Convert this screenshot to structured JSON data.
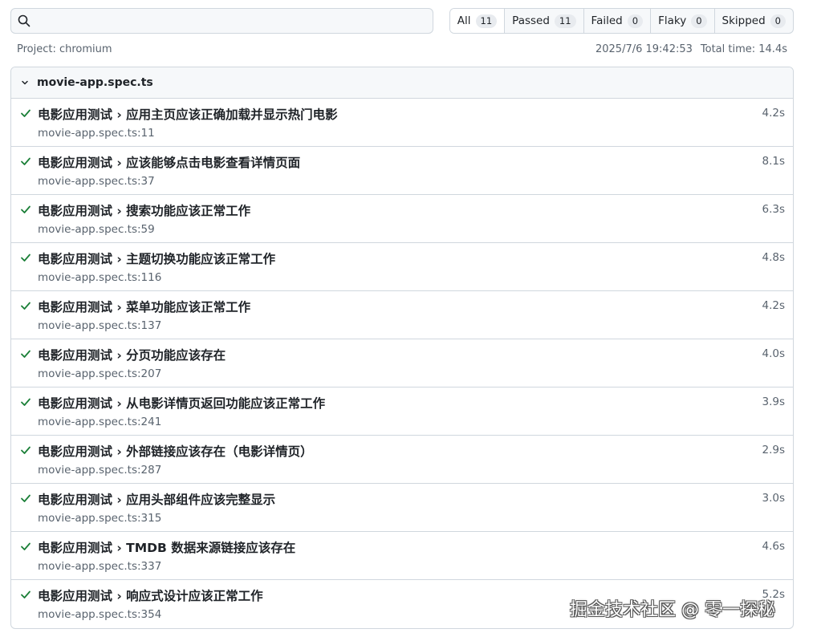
{
  "search": {
    "placeholder": "",
    "value": ""
  },
  "filters": [
    {
      "label": "All",
      "count": "11"
    },
    {
      "label": "Passed",
      "count": "11"
    },
    {
      "label": "Failed",
      "count": "0"
    },
    {
      "label": "Flaky",
      "count": "0"
    },
    {
      "label": "Skipped",
      "count": "0"
    }
  ],
  "meta": {
    "project": "Project: chromium",
    "timestamp": "2025/7/6 19:42:53",
    "total_time": "Total time: 14.4s"
  },
  "file": {
    "name": "movie-app.spec.ts",
    "tests": [
      {
        "title": "电影应用测试 › 应用主页应该正确加载并显示热门电影",
        "location": "movie-app.spec.ts:11",
        "duration": "4.2s",
        "status": "passed"
      },
      {
        "title": "电影应用测试 › 应该能够点击电影查看详情页面",
        "location": "movie-app.spec.ts:37",
        "duration": "8.1s",
        "status": "passed"
      },
      {
        "title": "电影应用测试 › 搜索功能应该正常工作",
        "location": "movie-app.spec.ts:59",
        "duration": "6.3s",
        "status": "passed"
      },
      {
        "title": "电影应用测试 › 主题切换功能应该正常工作",
        "location": "movie-app.spec.ts:116",
        "duration": "4.8s",
        "status": "passed"
      },
      {
        "title": "电影应用测试 › 菜单功能应该正常工作",
        "location": "movie-app.spec.ts:137",
        "duration": "4.2s",
        "status": "passed"
      },
      {
        "title": "电影应用测试 › 分页功能应该存在",
        "location": "movie-app.spec.ts:207",
        "duration": "4.0s",
        "status": "passed"
      },
      {
        "title": "电影应用测试 › 从电影详情页返回功能应该正常工作",
        "location": "movie-app.spec.ts:241",
        "duration": "3.9s",
        "status": "passed"
      },
      {
        "title": "电影应用测试 › 外部链接应该存在（电影详情页）",
        "location": "movie-app.spec.ts:287",
        "duration": "2.9s",
        "status": "passed"
      },
      {
        "title": "电影应用测试 › 应用头部组件应该完整显示",
        "location": "movie-app.spec.ts:315",
        "duration": "3.0s",
        "status": "passed"
      },
      {
        "title": "电影应用测试 › TMDB 数据来源链接应该存在",
        "location": "movie-app.spec.ts:337",
        "duration": "4.6s",
        "status": "passed"
      },
      {
        "title": "电影应用测试 › 响应式设计应该正常工作",
        "location": "movie-app.spec.ts:354",
        "duration": "5.2s",
        "status": "passed"
      }
    ]
  },
  "icons": {
    "search": "search-icon",
    "chevron": "chevron-down-icon",
    "check": "check-icon"
  },
  "colors": {
    "passed": "#1a7f37",
    "border": "#d0d7de",
    "muted": "#59636e"
  },
  "watermark": "掘金技术社区 @ 零一探秘"
}
